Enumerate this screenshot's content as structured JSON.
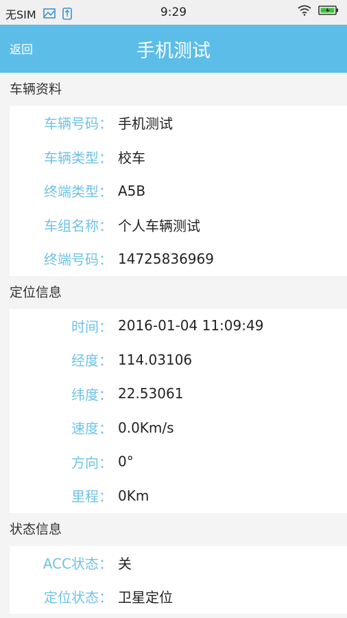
{
  "status_bar": {
    "carrier": "无SIM",
    "time": "9:29"
  },
  "header": {
    "back_label": "返回",
    "title": "手机测试"
  },
  "sections": [
    {
      "title": "车辆资料",
      "rows": [
        {
          "label": "车辆号码：",
          "value": "手机测试"
        },
        {
          "label": "车辆类型：",
          "value": "校车"
        },
        {
          "label": "终端类型：",
          "value": "A5B"
        },
        {
          "label": "车组名称：",
          "value": "个人车辆测试"
        },
        {
          "label": "终端号码：",
          "value": "14725836969"
        }
      ]
    },
    {
      "title": "定位信息",
      "rows": [
        {
          "label": "时间：",
          "value": "2016-01-04 11:09:49"
        },
        {
          "label": "经度：",
          "value": "114.03106"
        },
        {
          "label": "纬度：",
          "value": "22.53061"
        },
        {
          "label": "速度：",
          "value": "0.0Km/s"
        },
        {
          "label": "方向：",
          "value": "0°"
        },
        {
          "label": "里程：",
          "value": "0Km"
        }
      ]
    },
    {
      "title": "状态信息",
      "rows": [
        {
          "label": "ACC状态：",
          "value": "关"
        },
        {
          "label": "定位状态：",
          "value": "卫星定位"
        }
      ]
    }
  ],
  "colors": {
    "header_bg": "#5cbde9",
    "label": "#6fc3e6"
  }
}
